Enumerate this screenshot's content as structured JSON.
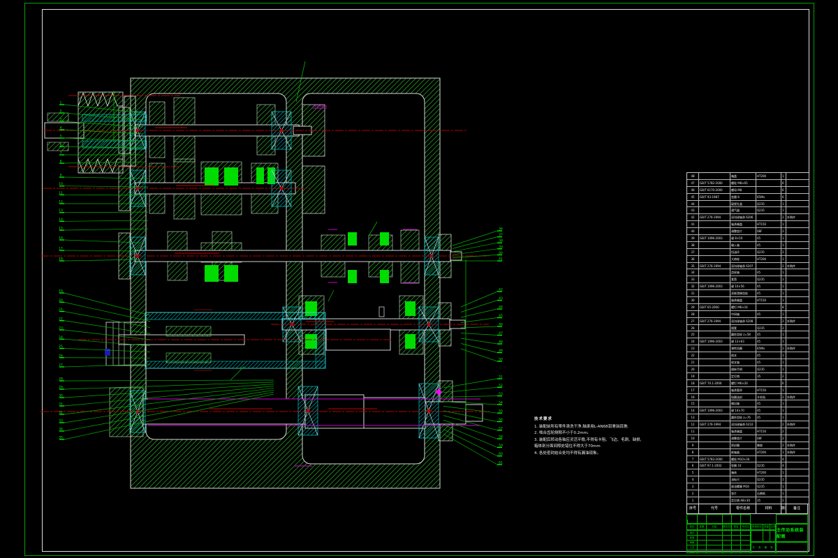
{
  "drawing": {
    "kind": "machine-tool main drive gearbox assembly, CAD section view",
    "background": "#000000"
  },
  "colors": {
    "border_green": "#00a400",
    "leader_green": "#00b400",
    "bright_green": "#00ff00",
    "gear_green": "#00dc00",
    "hatch_green": "#2ea82e",
    "white": "#e8e8e8",
    "centerline_red": "#b40000",
    "magenta": "#cc00cc",
    "cyan": "#00c8c8",
    "blue": "#1b1bb4"
  },
  "notes": {
    "title": "技术要求",
    "lines": [
      "1. 装配前所有零件清洗干净,轴承用L-AN68润滑油润滑;",
      "2. 啮合齿轮侧隙不小于0.2mm;",
      "3. 装配后转动各轴应灵活平稳,不得有卡阻、飞边、毛刺、缺损,",
      "箱体剖分面间隙处错位不得大于70mm",
      "4. 各处密封结合处均不得有漏油现象。"
    ]
  },
  "bom": {
    "header": [
      "序号",
      "代号",
      "零件名称",
      "材料",
      "数量",
      "备注"
    ],
    "rows": [
      [
        "48",
        "",
        "箱盖",
        "HT200",
        "1",
        ""
      ],
      [
        "47",
        "GB/T 5782-2000",
        "螺栓 M8×65",
        "",
        "6",
        ""
      ],
      [
        "46",
        "GB/T 6170-2000",
        "螺母 M8",
        "",
        "6",
        ""
      ],
      [
        "45",
        "GB/T 93-1987",
        "垫圈 8",
        "65Mn",
        "6",
        ""
      ],
      [
        "44",
        "",
        "窥视孔盖",
        "Q235",
        "1",
        ""
      ],
      [
        "43",
        "",
        "通气器",
        "Q235",
        "1",
        ""
      ],
      [
        "42",
        "GB/T 276-1994",
        "深沟球轴承 6206",
        "",
        "2",
        "外购件"
      ],
      [
        "41",
        "",
        "轴承端盖",
        "HT150",
        "1",
        ""
      ],
      [
        "40",
        "",
        "调整垫片",
        "08F",
        "2",
        ""
      ],
      [
        "39",
        "GB/T 1096-2003",
        "键 8×50",
        "45",
        "1",
        ""
      ],
      [
        "38",
        "",
        "输入轴",
        "45",
        "1",
        ""
      ],
      [
        "37",
        "",
        "挡油环",
        "Q235",
        "2",
        ""
      ],
      [
        "36",
        "",
        "大带轮",
        "HT200",
        "1",
        ""
      ],
      [
        "35",
        "GB/T 276-1994",
        "深沟球轴承 6207",
        "",
        "2",
        "外购件"
      ],
      [
        "34",
        "",
        "齿轮轴",
        "45",
        "1",
        ""
      ],
      [
        "33",
        "",
        "套筒",
        "Q235",
        "1",
        ""
      ],
      [
        "32",
        "GB/T 1096-2003",
        "键 10×56",
        "45",
        "1",
        ""
      ],
      [
        "31",
        "",
        "双联滑移齿轮",
        "45",
        "1",
        ""
      ],
      [
        "30",
        "",
        "轴承端盖",
        "HT150",
        "1",
        ""
      ],
      [
        "29",
        "GB/T 65-2000",
        "螺钉 M6×16",
        "",
        "8",
        ""
      ],
      [
        "28",
        "",
        "中间轴",
        "45",
        "1",
        ""
      ],
      [
        "27",
        "GB/T 276-1994",
        "深沟球轴承 6208",
        "",
        "2",
        "外购件"
      ],
      [
        "26",
        "",
        "隔套",
        "Q235",
        "2",
        ""
      ],
      [
        "25",
        "",
        "圆柱齿轮 z=58",
        "45",
        "1",
        ""
      ],
      [
        "24",
        "GB/T 1096-2003",
        "键 12×63",
        "45",
        "1",
        ""
      ],
      [
        "23",
        "",
        "弹性挡圈",
        "65Mn",
        "2",
        "外购件"
      ],
      [
        "22",
        "",
        "拨叉",
        "45",
        "1",
        ""
      ],
      [
        "21",
        "",
        "拨叉轴",
        "45",
        "1",
        ""
      ],
      [
        "20",
        "",
        "操纵手柄",
        "Q235",
        "1",
        ""
      ],
      [
        "19",
        "",
        "定位销",
        "35",
        "2",
        ""
      ],
      [
        "18",
        "GB/T 70.1-2000",
        "螺钉 M6×20",
        "",
        "6",
        ""
      ],
      [
        "17",
        "",
        "轴承套杯",
        "HT150",
        "1",
        ""
      ],
      [
        "16",
        "",
        "毡圈油封",
        "羊毛毡",
        "2",
        "外购件"
      ],
      [
        "15",
        "",
        "输出轴",
        "45",
        "1",
        ""
      ],
      [
        "14",
        "GB/T 1096-2003",
        "键 14×70",
        "45",
        "1",
        ""
      ],
      [
        "13",
        "",
        "圆柱齿轮 z=76",
        "45",
        "1",
        ""
      ],
      [
        "12",
        "GB/T 276-1994",
        "深沟球轴承 6210",
        "",
        "2",
        "外购件"
      ],
      [
        "11",
        "",
        "轴承端盖",
        "HT150",
        "2",
        ""
      ],
      [
        "10",
        "",
        "调整垫片",
        "08F",
        "2",
        ""
      ],
      [
        "9",
        "",
        "密封圈",
        "橡胶",
        "2",
        "外购件"
      ],
      [
        "8",
        "",
        "联轴器",
        "HT200",
        "1",
        "外购件"
      ],
      [
        "7",
        "GB/T 5783-2000",
        "螺栓 M10×30",
        "",
        "4",
        ""
      ],
      [
        "6",
        "GB/T 97.1-2002",
        "垫圈 10",
        "Q235",
        "4",
        ""
      ],
      [
        "5",
        "",
        "箱体",
        "HT200",
        "1",
        ""
      ],
      [
        "4",
        "",
        "油标尺",
        "Q235",
        "1",
        ""
      ],
      [
        "3",
        "",
        "放油螺塞 M16",
        "Q235",
        "1",
        ""
      ],
      [
        "2",
        "",
        "垫片",
        "石棉纸",
        "1",
        ""
      ],
      [
        "1",
        "",
        "定位销 A8×30",
        "35",
        "2",
        ""
      ]
    ]
  },
  "title_block": {
    "title": "主传动系统装配图",
    "change_row": [
      "标记",
      "处数",
      "分区",
      "更改文件号",
      "签名",
      "年月日"
    ],
    "roles": [
      "设计",
      "校核",
      "审核",
      "工艺",
      "批准"
    ],
    "stage_label": "阶段标记",
    "mass_label": "质量",
    "scale_label": "比例",
    "sheet_text": "共 张 第 张"
  },
  "callouts": {
    "left": [
      "1",
      "2",
      "3",
      "4",
      "5",
      "6",
      "7",
      "8",
      "9",
      "10",
      "11",
      "12",
      "13",
      "14",
      "15",
      "16",
      "17",
      "18",
      "19",
      "20",
      "21",
      "22",
      "23",
      "24",
      "25",
      "26",
      "27",
      "28",
      "29",
      "30",
      "31",
      "32",
      "33",
      "34",
      "35"
    ],
    "right": [
      "36",
      "37",
      "38",
      "39",
      "40",
      "41",
      "42",
      "43",
      "44",
      "45",
      "46",
      "47",
      "48",
      "49",
      "50",
      "51",
      "52",
      "53",
      "54",
      "55",
      "56",
      "57",
      "58",
      "59",
      "60",
      "61"
    ]
  }
}
